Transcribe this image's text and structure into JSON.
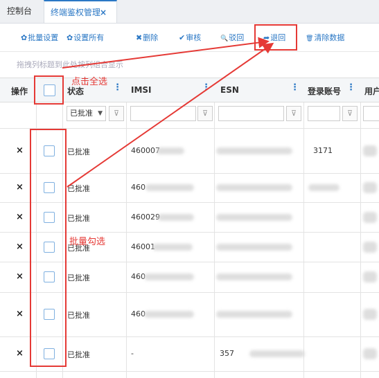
{
  "tabs": {
    "home": "控制台",
    "active": "终端鉴权管理",
    "close": "×"
  },
  "toolbar": {
    "batch_set": {
      "icon": "✿",
      "label": "批量设置"
    },
    "set_all": {
      "icon": "✿",
      "label": "设置所有"
    },
    "delete": {
      "icon": "✖",
      "label": "删除"
    },
    "approve": {
      "icon": "✔",
      "label": "审核"
    },
    "reject": {
      "icon": "🔍",
      "label": "驳回"
    },
    "return": {
      "icon": "➦",
      "label": "退回"
    },
    "clear": {
      "icon": "🗑",
      "label": "清除数据"
    }
  },
  "group_hint": "拖拽列标题到此处按列组合显示",
  "columns": {
    "op": "操作",
    "status": "状态",
    "imsi": "IMSI",
    "esn": "ESN",
    "account": "登录账号",
    "user": "用户"
  },
  "filter": {
    "status_value": "已批准",
    "caret": "▼",
    "filter_icon": "⊽"
  },
  "rows": [
    {
      "del": "×",
      "status": "已批准",
      "imsi": "460007",
      "esn": "",
      "account": "3171"
    },
    {
      "del": "×",
      "status": "已批准",
      "imsi": "460",
      "esn": "",
      "account": ""
    },
    {
      "del": "×",
      "status": "已批准",
      "imsi": "460029",
      "esn": "",
      "account": ""
    },
    {
      "del": "×",
      "status": "已批准",
      "imsi": "46001",
      "esn": "",
      "account": ""
    },
    {
      "del": "×",
      "status": "已批准",
      "imsi": "460",
      "esn": "",
      "account": ""
    },
    {
      "del": "×",
      "status": "已批准",
      "imsi": "460",
      "esn": "",
      "account": ""
    },
    {
      "del": "×",
      "status": "已批准",
      "imsi": "-",
      "esn": "357",
      "account": ""
    }
  ],
  "annotations": {
    "select_all": "点击全选",
    "batch_check": "批量勾选"
  }
}
